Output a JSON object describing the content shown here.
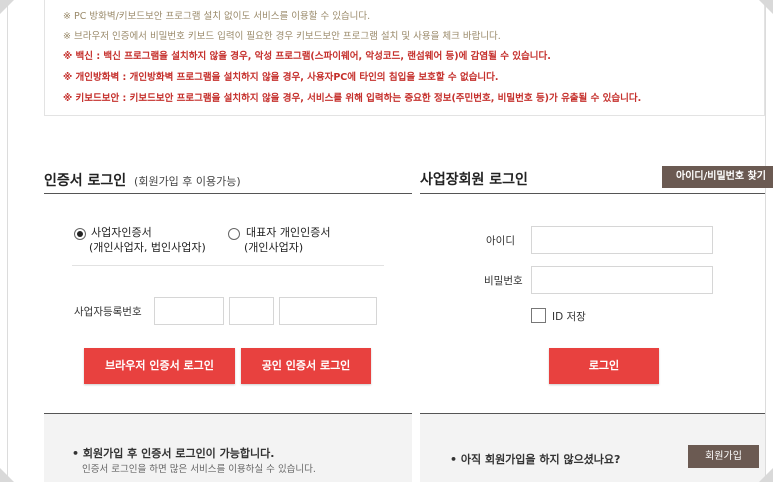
{
  "notices": {
    "line1": "※ PC 방화벽/키보드보안 프로그램 설치 없이도 서비스를 이용할 수 있습니다.",
    "line2": "※ 브라우저 인증에서 비밀번호 키보드 입력이 필요한 경우 키보드보안 프로그램 설치 및 사용을 체크 바랍니다.",
    "line3": "※ 백신 : 백신 프로그램을 설치하지 않을 경우, 악성 프로그램(스파이웨어, 악성코드, 랜섬웨어 등)에 감염될 수 있습니다.",
    "line4": "※ 개인방화벽 : 개인방화벽 프로그램을 설치하지 않을 경우, 사용자PC에 타인의 침입을 보호할 수 없습니다.",
    "line5": "※ 키보드보안 : 키보드보안 프로그램을 설치하지 않을 경우, 서비스를 위해 입력하는 중요한 정보(주민번호, 비밀번호 등)가 유출될 수 있습니다."
  },
  "cert_login": {
    "title": "인증서 로그인",
    "subtitle": "(회원가입 후 이용가능)",
    "radio_business": {
      "label": "사업자인증서",
      "sub": "(개인사업자, 법인사업자)",
      "checked": true
    },
    "radio_rep": {
      "label": "대표자 개인인증서",
      "sub": "(개인사업자)",
      "checked": false
    },
    "biz_number_label": "사업자등록번호",
    "biz_number_values": [
      "",
      "",
      ""
    ],
    "browser_cert_button": "브라우저 인증서 로그인",
    "public_cert_button": "공인 인증서 로그인",
    "footer_text": "회원가입 후 인증서 로그인이 가능합니다.",
    "footer_sub": "인증서 로그인을 하면 많은 서비스를 이용하실 수 있습니다."
  },
  "member_login": {
    "title": "사업장회원 로그인",
    "find_button": "아이디/비밀번호 찾기",
    "id_label": "아이디",
    "id_value": "",
    "pw_label": "비밀번호",
    "pw_value": "",
    "save_id_label": "ID 저장",
    "save_id_checked": false,
    "login_button": "로그인",
    "footer_text": "아직 회원가입을 하지 않으셨나요?",
    "join_button": "회원가입"
  },
  "colors": {
    "accent_red": "#e8413f",
    "button_brown": "#6b5a52",
    "notice_red": "#c5302c"
  }
}
